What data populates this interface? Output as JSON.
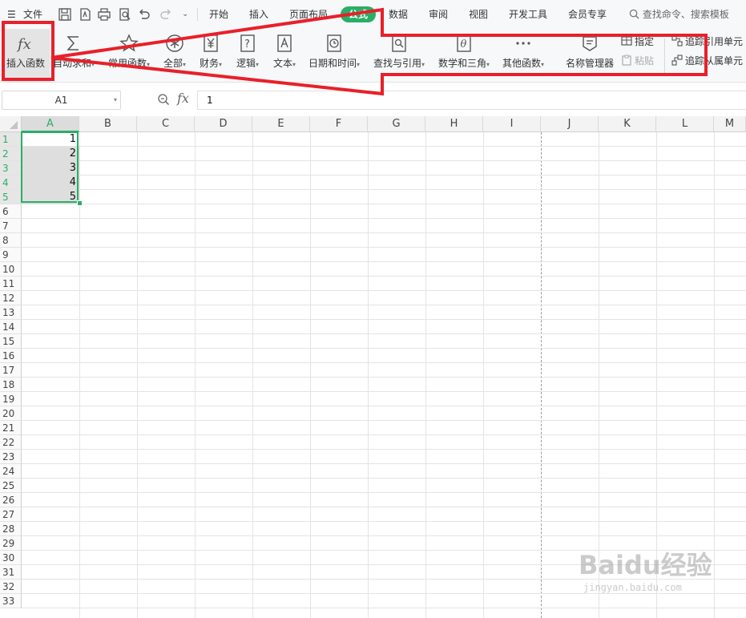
{
  "menubar": {
    "file_label": "文件",
    "tabs": [
      {
        "label": "开始"
      },
      {
        "label": "插入"
      },
      {
        "label": "页面布局"
      },
      {
        "label": "公式"
      },
      {
        "label": "数据"
      },
      {
        "label": "审阅"
      },
      {
        "label": "视图"
      },
      {
        "label": "开发工具"
      },
      {
        "label": "会员专享"
      }
    ],
    "search_placeholder": "查找命令、搜索模板",
    "active_tab_color": "#2aae67"
  },
  "ribbon": {
    "buttons": [
      {
        "label": "插入函数",
        "icon": "fx-icon"
      },
      {
        "label": "自动求和",
        "icon": "sigma-icon"
      },
      {
        "label": "常用函数",
        "icon": "star-icon"
      },
      {
        "label": "全部",
        "icon": "asterisk-circle-icon"
      },
      {
        "label": "财务",
        "icon": "yen-icon"
      },
      {
        "label": "逻辑",
        "icon": "question-icon"
      },
      {
        "label": "文本",
        "icon": "text-a-icon"
      },
      {
        "label": "日期和时间",
        "icon": "clock-icon"
      },
      {
        "label": "查找与引用",
        "icon": "search-doc-icon"
      },
      {
        "label": "数学和三角",
        "icon": "theta-icon"
      },
      {
        "label": "其他函数",
        "icon": "more-dots-icon"
      },
      {
        "label": "名称管理器",
        "icon": "name-manager-icon"
      }
    ],
    "small_buttons": [
      {
        "label": "指定"
      },
      {
        "label": "粘贴"
      },
      {
        "label": "追踪引用单元"
      },
      {
        "label": "追踪从属单元"
      }
    ]
  },
  "formula_bar": {
    "name_box": "A1",
    "fx_label": "fx",
    "content": "1"
  },
  "sheet": {
    "columns": [
      "A",
      "B",
      "C",
      "D",
      "E",
      "F",
      "G",
      "H",
      "I",
      "J",
      "K",
      "L",
      "M"
    ],
    "rows": [
      "1",
      "2",
      "3",
      "4",
      "5",
      "6",
      "7",
      "8",
      "9",
      "10",
      "11",
      "12",
      "13",
      "14",
      "15",
      "16",
      "17",
      "18",
      "19",
      "20",
      "21",
      "22",
      "23",
      "24",
      "25",
      "26",
      "27",
      "28",
      "29",
      "30",
      "31",
      "32",
      "33"
    ],
    "cells": [
      "1",
      "2",
      "3",
      "4",
      "5"
    ],
    "selection_color": "#2aae67"
  },
  "annotation": {
    "color": "#e8202a"
  },
  "watermark": {
    "main": "Baidu经验",
    "sub": "jingyan.baidu.com"
  }
}
